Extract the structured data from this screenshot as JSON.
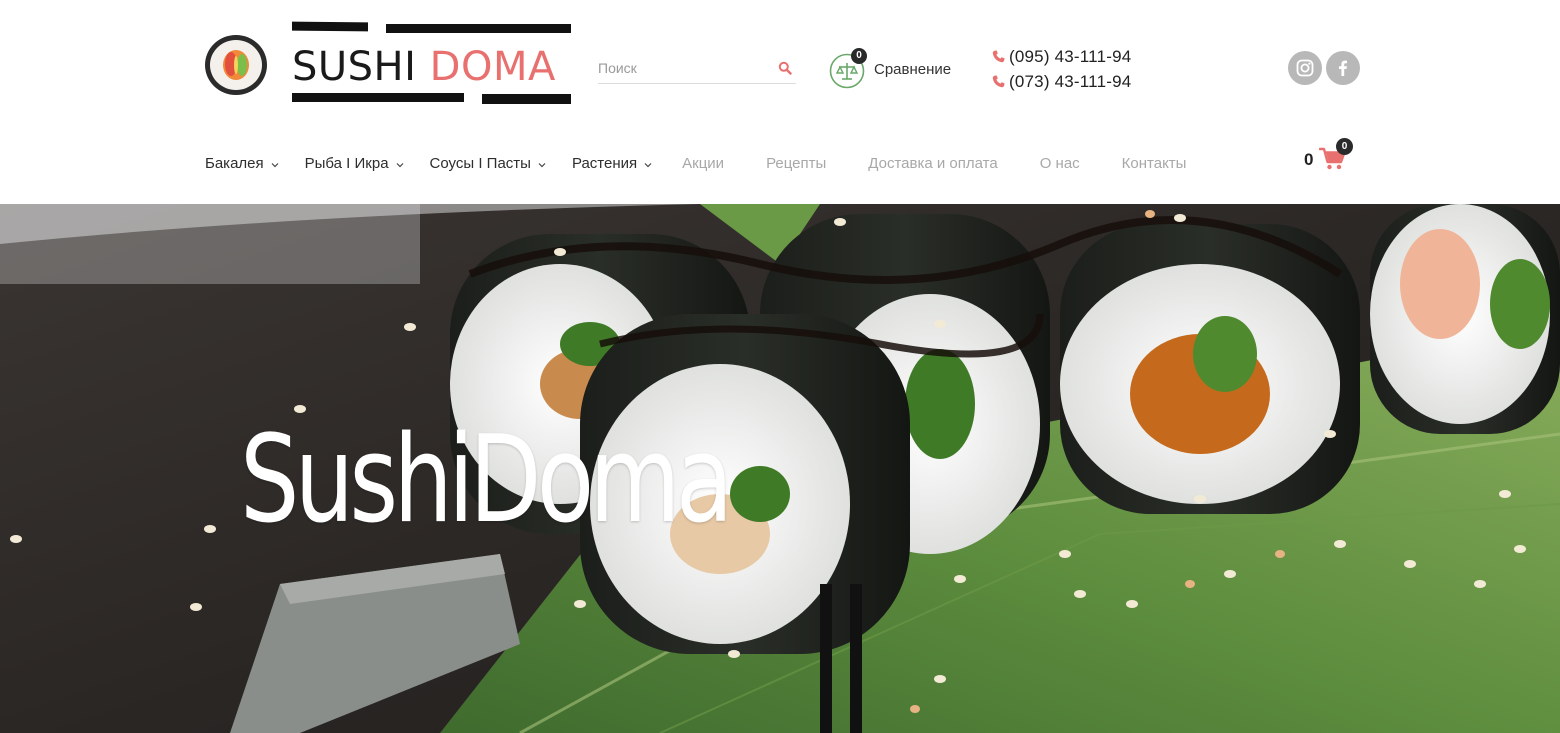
{
  "brand": {
    "word1": "SUSHI",
    "word2": "DOMA",
    "accent_color": "#e8716f"
  },
  "search": {
    "placeholder": "Поиск",
    "icon": "search-icon"
  },
  "compare": {
    "label": "Сравнение",
    "count": "0",
    "icon": "scales-icon"
  },
  "contacts": {
    "phones": [
      "(095) 43-111-94",
      "(073) 43-111-94"
    ],
    "icon": "phone-icon"
  },
  "social": [
    {
      "name": "instagram",
      "icon": "instagram-icon"
    },
    {
      "name": "facebook",
      "icon": "facebook-icon"
    }
  ],
  "nav": {
    "items": [
      {
        "label": "Бакалея",
        "has_dropdown": true
      },
      {
        "label": "Рыба I Икра",
        "has_dropdown": true
      },
      {
        "label": "Соусы I Пасты",
        "has_dropdown": true
      },
      {
        "label": "Растения",
        "has_dropdown": true
      },
      {
        "label": "Акции",
        "has_dropdown": false
      },
      {
        "label": "Рецепты",
        "has_dropdown": false
      },
      {
        "label": "Доставка и оплата",
        "has_dropdown": false
      },
      {
        "label": "О нас",
        "has_dropdown": false
      },
      {
        "label": "Контакты",
        "has_dropdown": false
      }
    ]
  },
  "cart": {
    "total": "0",
    "count": "0",
    "icon": "cart-icon",
    "color": "#e8716f"
  },
  "hero": {
    "title": "SushiDoma"
  }
}
